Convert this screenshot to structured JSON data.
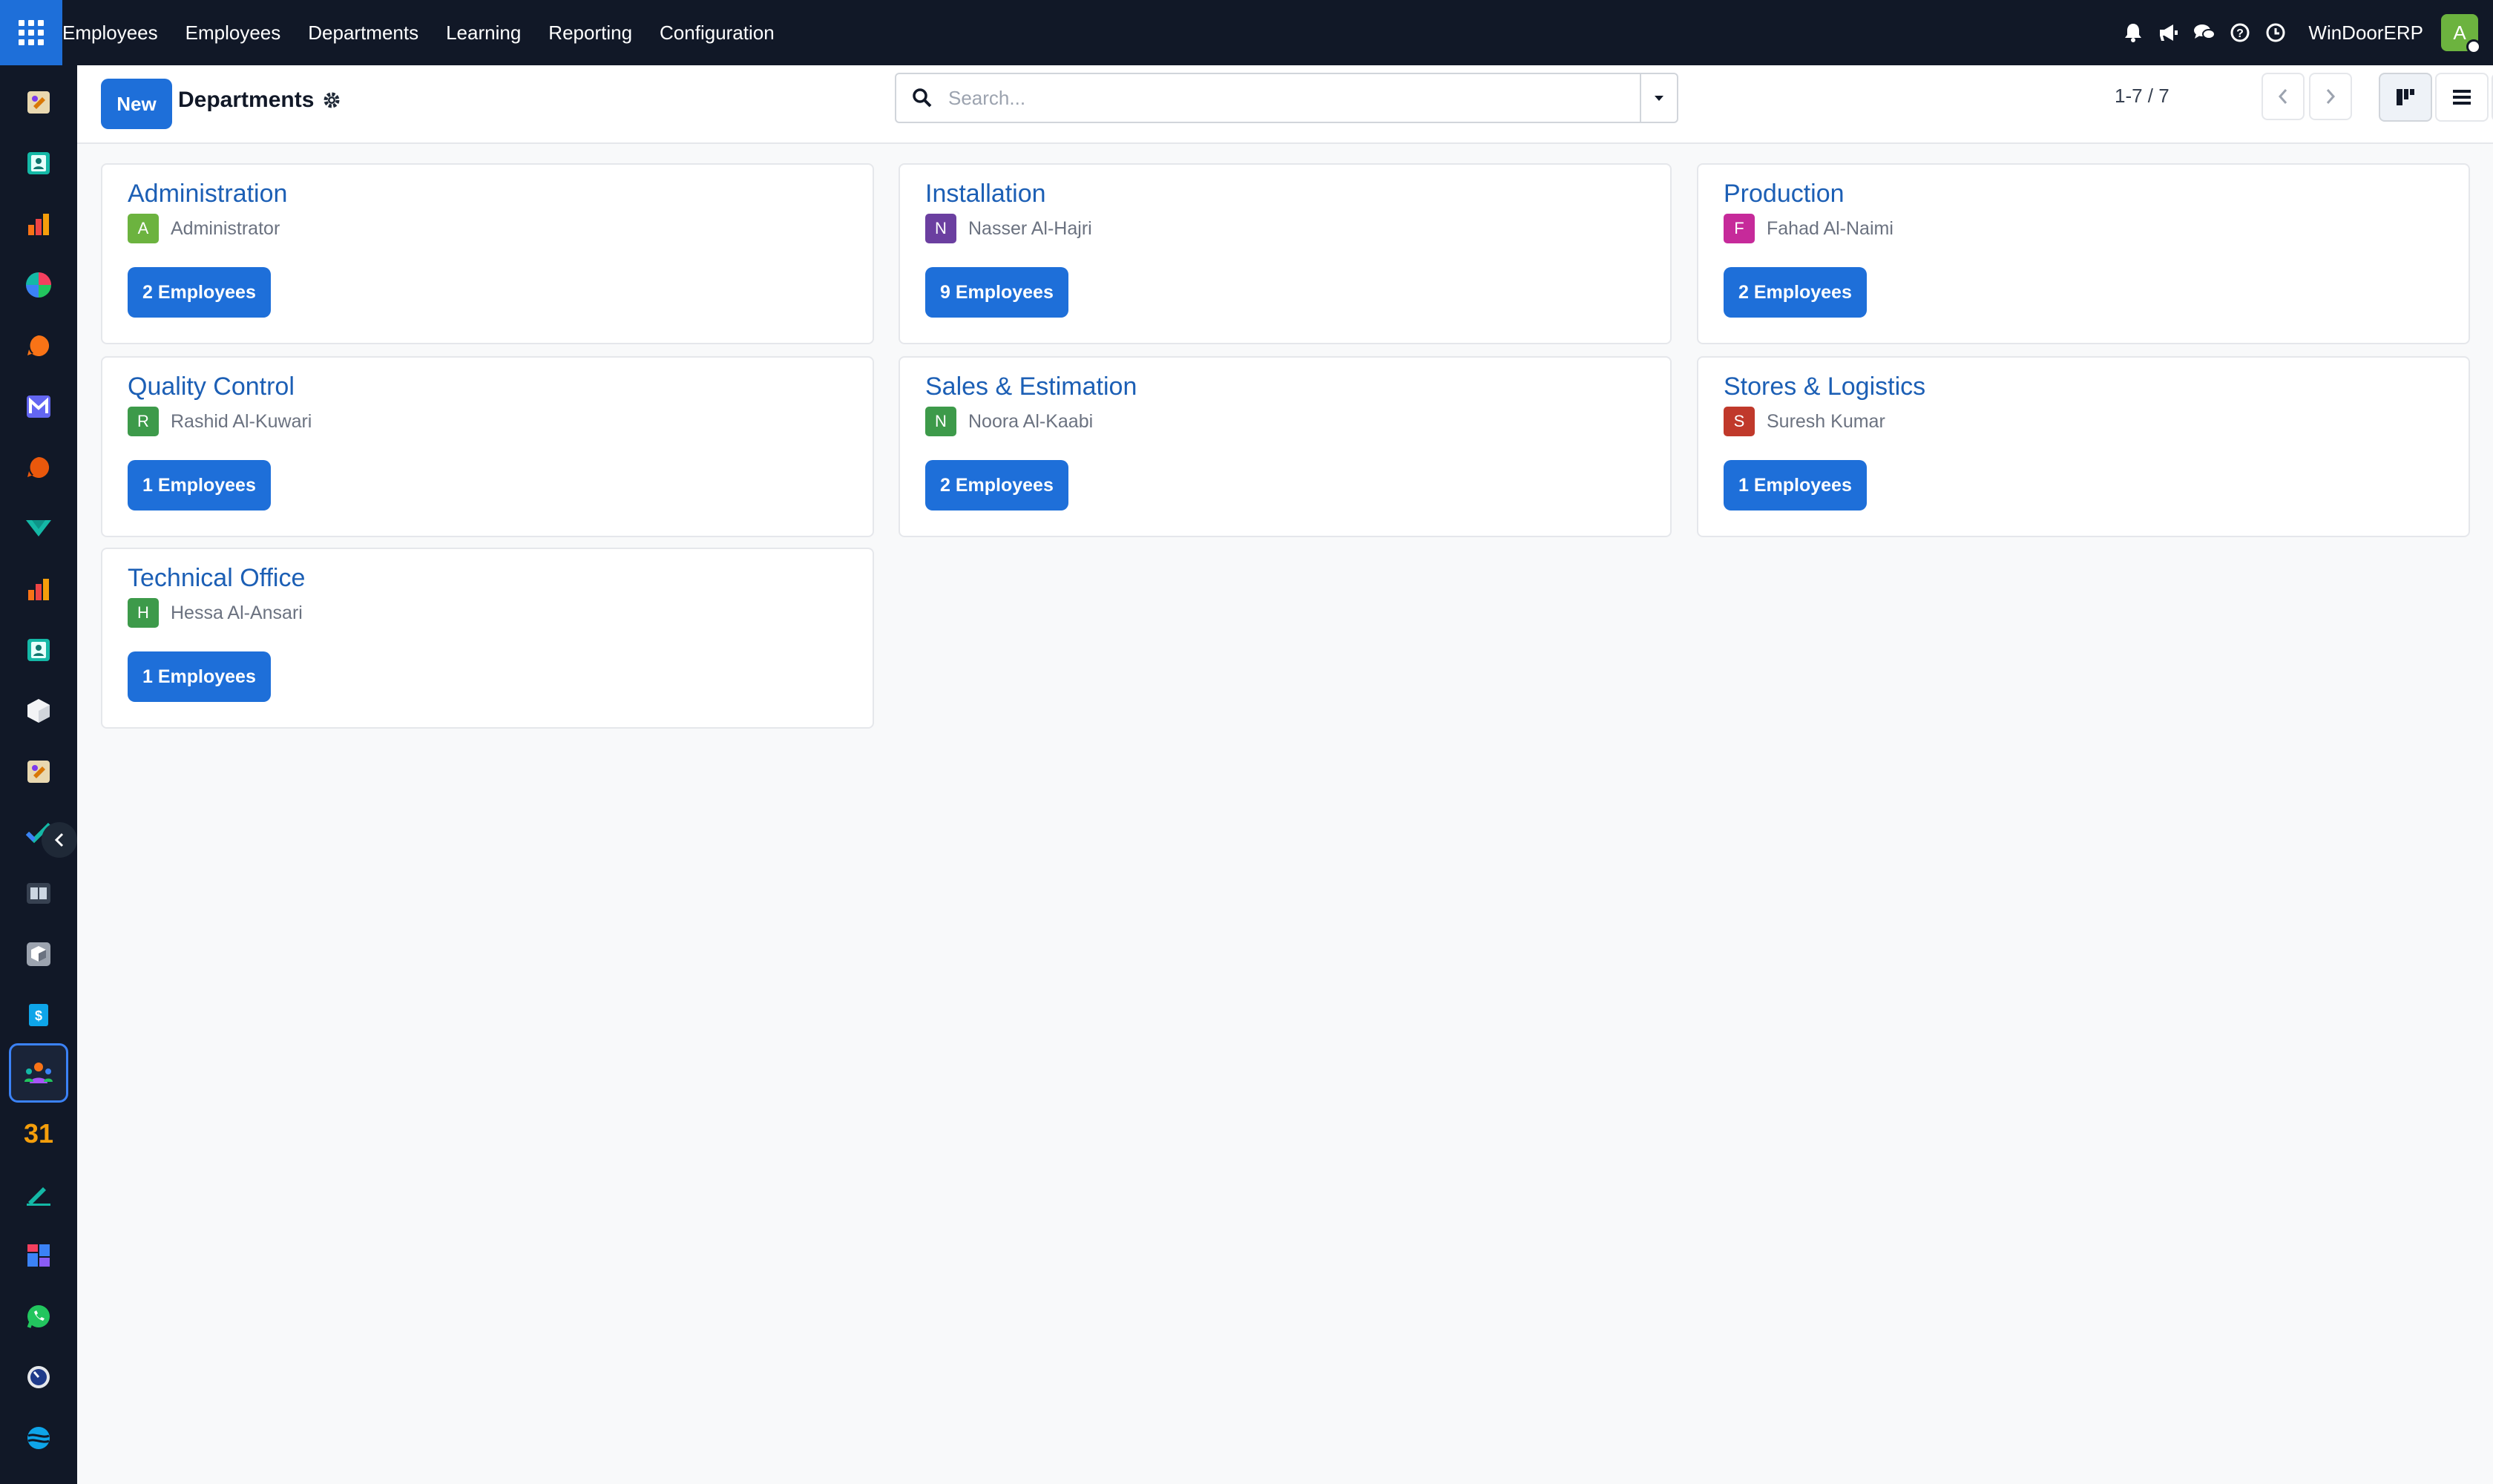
{
  "topbar": {
    "menu": [
      "Employees",
      "Employees",
      "Departments",
      "Learning",
      "Reporting",
      "Configuration"
    ],
    "company": "WinDoorERP",
    "user_initial": "A",
    "icons": [
      "bell-icon",
      "megaphone-icon",
      "chat-icon",
      "help-icon",
      "clock-icon"
    ]
  },
  "sidebar": {
    "apps": [
      "discuss-app",
      "contacts-app",
      "sales-app",
      "crm-app",
      "livechat-app",
      "email-marketing-app",
      "helpdesk-app",
      "project-app",
      "reporting-app",
      "employees-contacts-app",
      "inventory-app",
      "discuss-alt-app",
      "todo-app",
      "knowledge-app",
      "purchase-app",
      "invoicing-app",
      "employees-app",
      "calendar-app",
      "sign-app",
      "dashboard-app",
      "whatsapp-app",
      "timesheet-app",
      "website-app"
    ],
    "calendar_label": "31",
    "active": "employees-app"
  },
  "control": {
    "new_label": "New",
    "title": "Departments",
    "search_placeholder": "Search...",
    "pager": "1-7 / 7"
  },
  "departments": [
    {
      "name": "Administration",
      "manager": "Administrator",
      "initial": "A",
      "color": "#6cb33f",
      "employees": "2 Employees"
    },
    {
      "name": "Installation",
      "manager": "Nasser Al-Hajri",
      "initial": "N",
      "color": "#6b3fa0",
      "employees": "9 Employees"
    },
    {
      "name": "Production",
      "manager": "Fahad Al-Naimi",
      "initial": "F",
      "color": "#c62a9a",
      "employees": "2 Employees"
    },
    {
      "name": "Quality Control",
      "manager": "Rashid Al-Kuwari",
      "initial": "R",
      "color": "#3d9a4a",
      "employees": "1 Employees"
    },
    {
      "name": "Sales & Estimation",
      "manager": "Noora Al-Kaabi",
      "initial": "N",
      "color": "#3d9a4a",
      "employees": "2 Employees"
    },
    {
      "name": "Stores & Logistics",
      "manager": "Suresh Kumar",
      "initial": "S",
      "color": "#c0392b",
      "employees": "1 Employees"
    },
    {
      "name": "Technical Office",
      "manager": "Hessa Al-Ansari",
      "initial": "H",
      "color": "#3d9a4a",
      "employees": "1 Employees"
    }
  ]
}
